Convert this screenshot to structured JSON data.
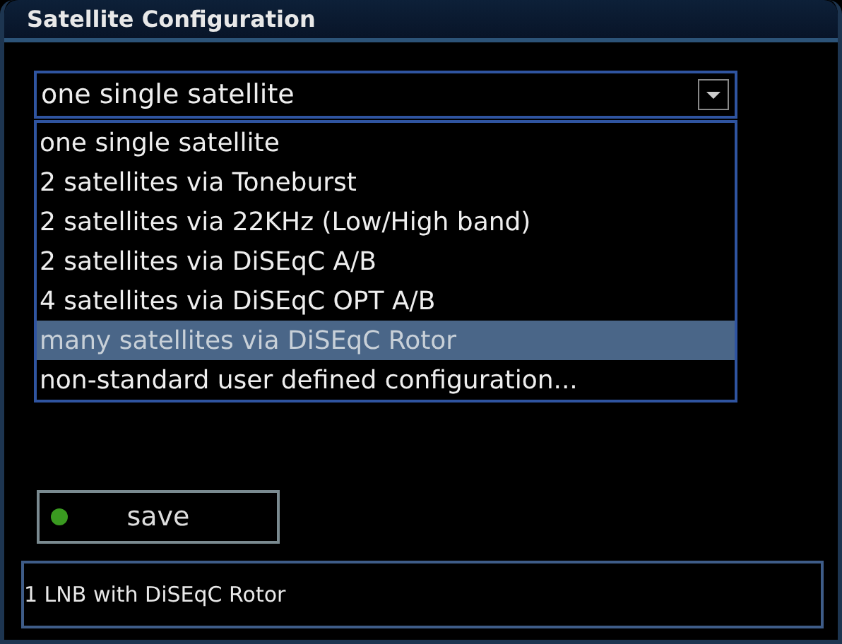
{
  "window": {
    "title": "Satellite Configuration"
  },
  "dropdown": {
    "value": "one single satellite",
    "expanded": true
  },
  "options": [
    {
      "label": "one single satellite",
      "selected": false
    },
    {
      "label": "2 satellites via Toneburst",
      "selected": false
    },
    {
      "label": "2 satellites via 22KHz (Low/High band)",
      "selected": false
    },
    {
      "label": "2 satellites via DiSEqC A/B",
      "selected": false
    },
    {
      "label": "4 satellites via DiSEqC OPT A/B",
      "selected": false
    },
    {
      "label": "many satellites via DiSEqC Rotor",
      "selected": true
    },
    {
      "label": "non-standard user defined configuration...",
      "selected": false
    }
  ],
  "save_button": {
    "label": "save",
    "color": "#3a9a20"
  },
  "info": "1 LNB with DiSEqC Rotor"
}
